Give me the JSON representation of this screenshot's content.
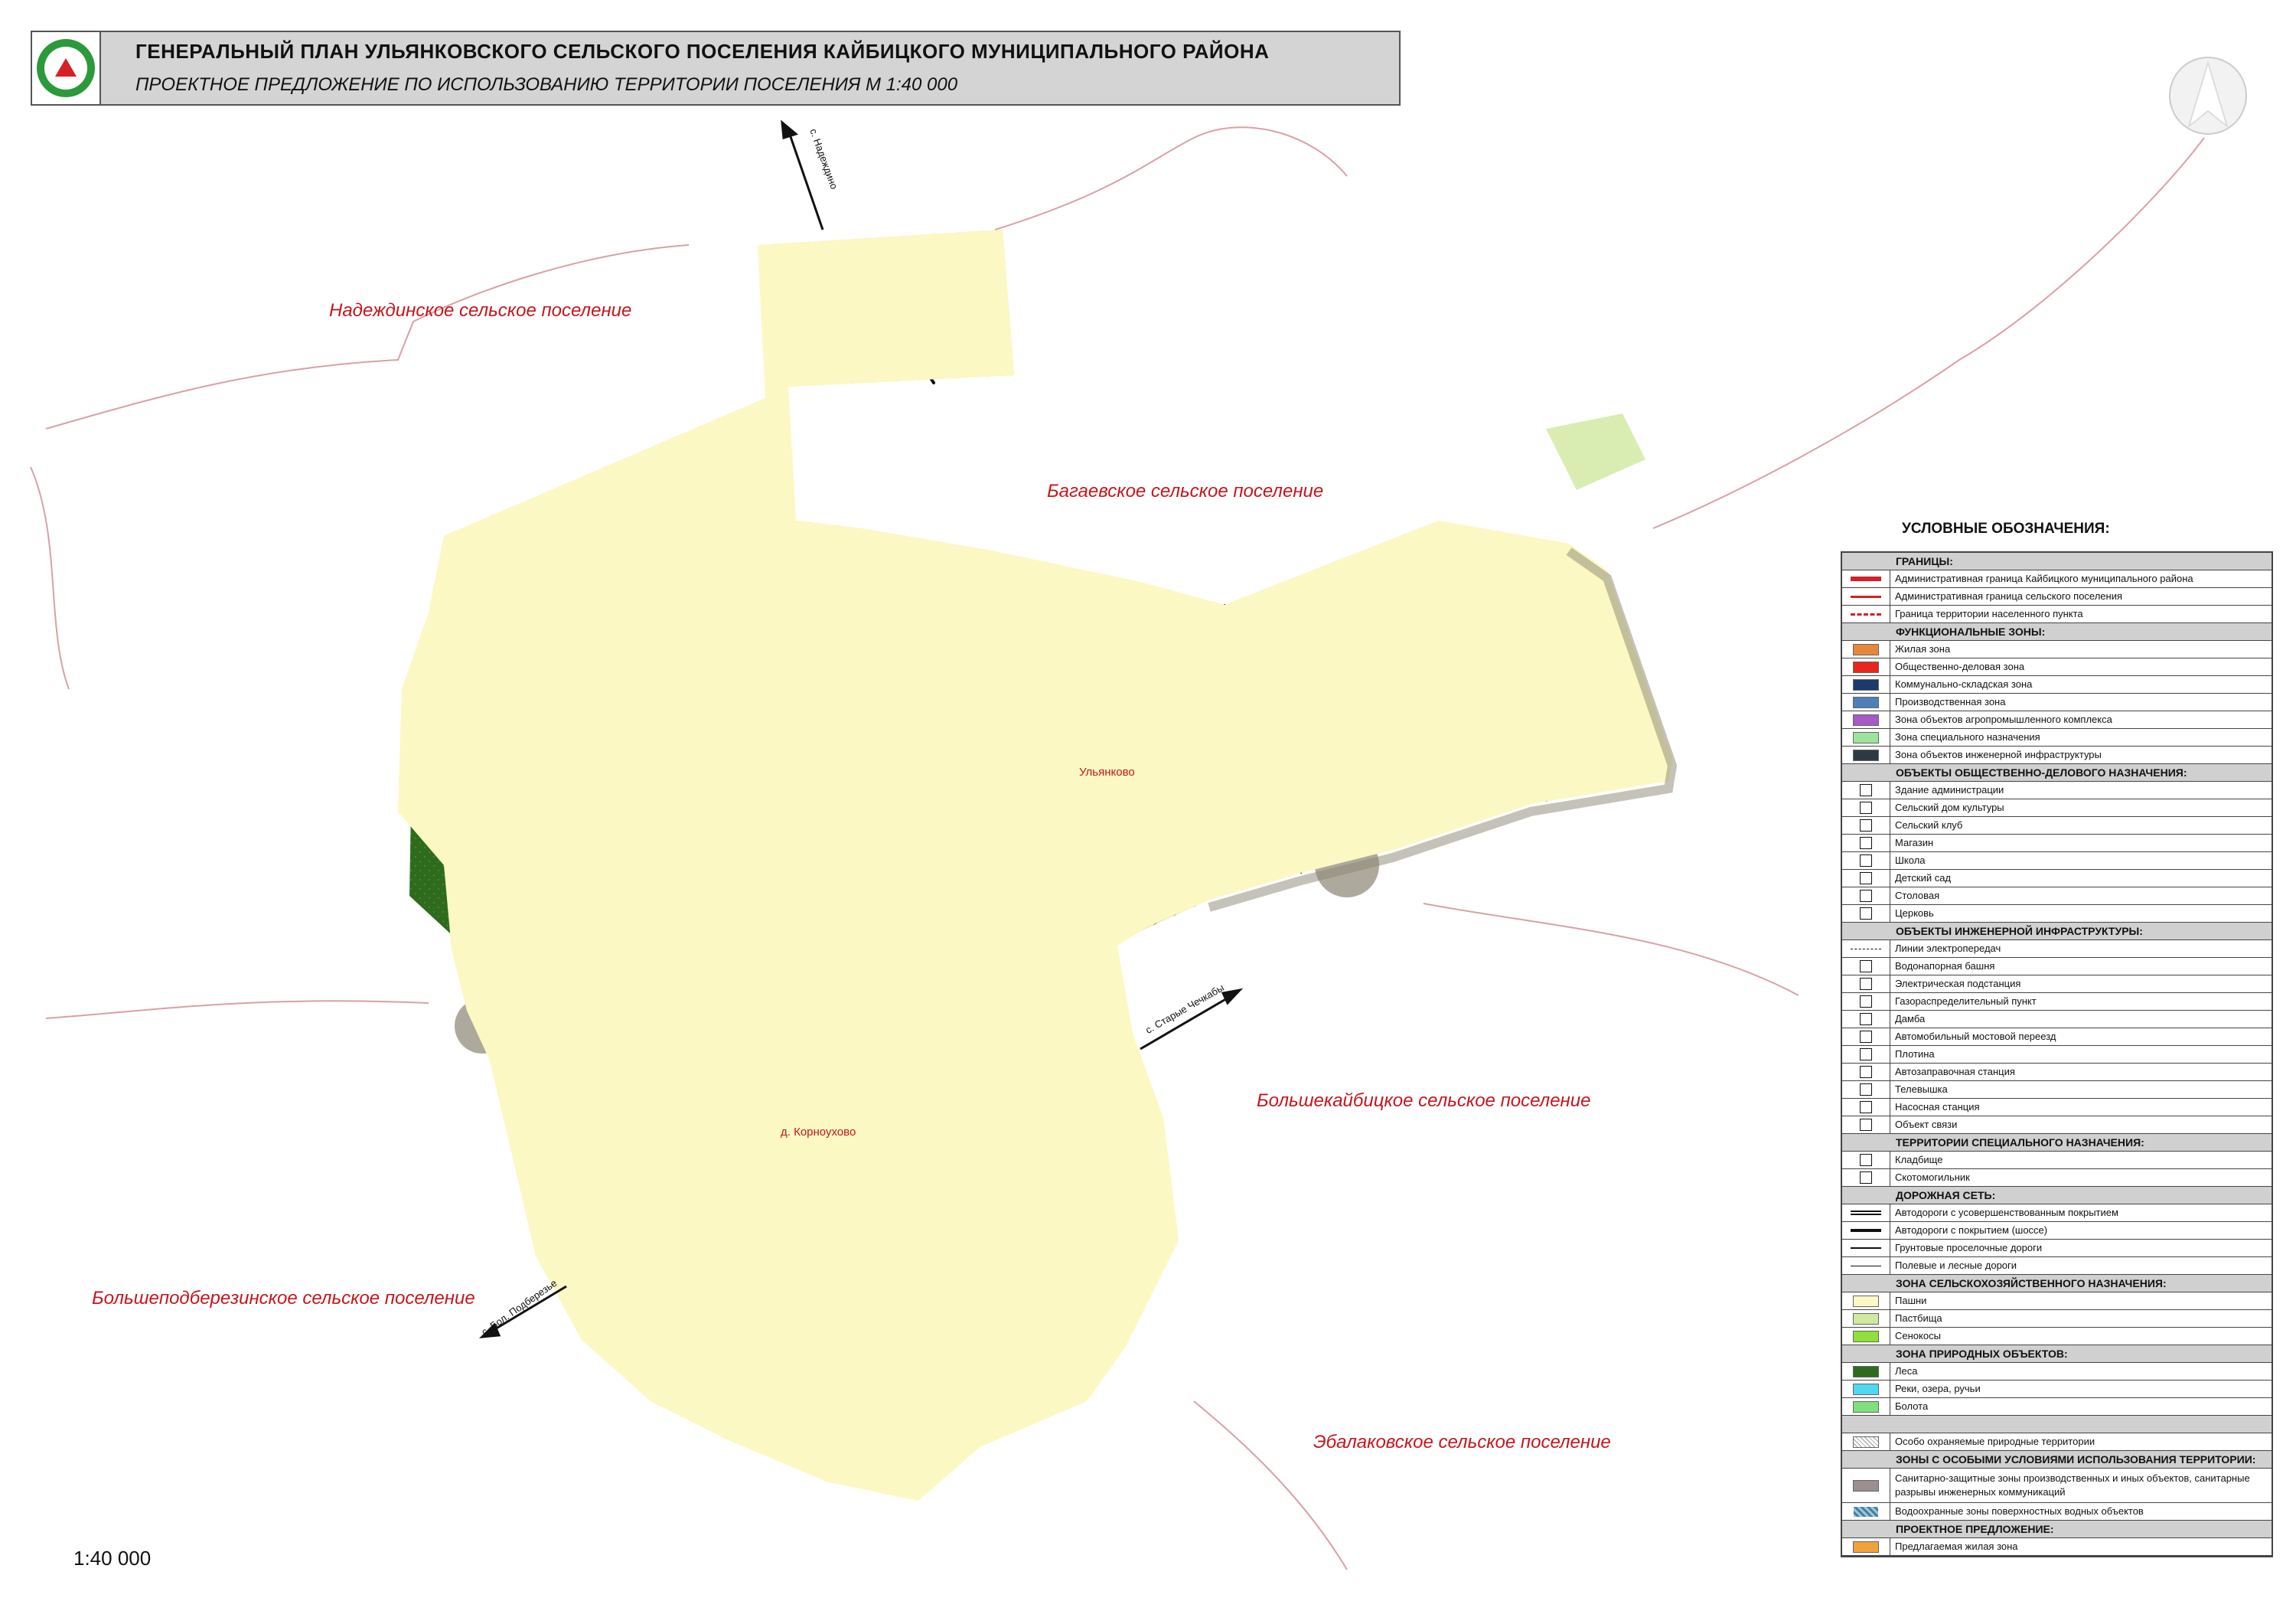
{
  "header": {
    "title": "ГЕНЕРАЛЬНЫЙ ПЛАН УЛЬЯНКОВСКОГО СЕЛЬСКОГО ПОСЕЛЕНИЯ КАЙБИЦКОГО МУНИЦИПАЛЬНОГО РАЙОНА",
    "subtitle": "ПРОЕКТНОЕ ПРЕДЛОЖЕНИЕ ПО  ИСПОЛЬЗОВАНИЮ ТЕРРИТОРИИ ПОСЕЛЕНИЯ  М 1:40 000"
  },
  "areas": {
    "nadezhdino": "Надеждинское сельское поселение",
    "bagaevo": "Багаевское сельское поселение",
    "bolshekaibitsy": "Большекайбицкое сельское поселение",
    "bolshepodberezino": "Большеподберезинское сельское поселение",
    "ebalakovo": "Эбалаковское сельское поселение"
  },
  "places": {
    "ulyankovo": "Ульянково",
    "korniukovo": "д. Корноухово",
    "road_north": "с. Надеждино",
    "road_east": "с. Старые Чечкабы",
    "road_southwest": "с. Бол. Подберезье"
  },
  "scale": "1:40 000",
  "colors": {
    "boundary": "#d42026",
    "arable": "#fbf8c3",
    "pasture": "#cfe9a0",
    "forest": "#2e6b1d",
    "water": "#4a8fb5",
    "sanitary": "#8c8573",
    "residential": "#e8a25a",
    "agro": "#a55ac8"
  },
  "legend": {
    "title": "УСЛОВНЫЕ ОБОЗНАЧЕНИЯ:",
    "sections": [
      {
        "title": "ГРАНИЦЫ:",
        "items": [
          {
            "sym": "line-red-thick",
            "label": "Административная граница Кайбицкого муниципального района"
          },
          {
            "sym": "line-red",
            "label": "Административная граница сельского поселения"
          },
          {
            "sym": "line-red-dash",
            "label": "Граница территории населенного пункта"
          }
        ]
      },
      {
        "title": "ФУНКЦИОНАЛЬНЫЕ ЗОНЫ:",
        "items": [
          {
            "sym": "rect:#e8863a",
            "label": "Жилая зона"
          },
          {
            "sym": "rect:#e8261c",
            "label": "Общественно-деловая зона"
          },
          {
            "sym": "rect:#1c3a6b",
            "label": "Коммунально-складская зона"
          },
          {
            "sym": "rect:#4f7fb8",
            "label": " Производственная зона"
          },
          {
            "sym": "rect:#a55ac8",
            "label": "Зона объектов агропромышленного комплекса"
          },
          {
            "sym": "rect:#9ce39c",
            "label": "Зона специального назначения"
          },
          {
            "sym": "rect:#2d3a44",
            "label": "Зона объектов инженерной инфраструктуры"
          }
        ]
      },
      {
        "title": "ОБЪЕКТЫ ОБЩЕСТВЕННО-ДЕЛОВОГО НАЗНАЧЕНИЯ:",
        "items": [
          {
            "sym": "icon",
            "label": "Здание администрации"
          },
          {
            "sym": "icon",
            "label": "Сельский дом культуры"
          },
          {
            "sym": "icon",
            "label": "Сельский клуб"
          },
          {
            "sym": "icon",
            "label": "Магазин"
          },
          {
            "sym": "icon",
            "label": "Школа"
          },
          {
            "sym": "icon",
            "label": "Детский сад"
          },
          {
            "sym": "icon",
            "label": "Столовая"
          },
          {
            "sym": "icon",
            "label": "Церковь"
          }
        ]
      },
      {
        "title": "ОБЪЕКТЫ ИНЖЕНЕРНОЙ ИНФРАСТРУКТУРЫ:",
        "items": [
          {
            "sym": "line-thin-dash",
            "label": "Линии электропередач"
          },
          {
            "sym": "icon",
            "label": "Водонапорная башня"
          },
          {
            "sym": "icon",
            "label": "Электрическая подстанция"
          },
          {
            "sym": "icon",
            "label": "Газораспределительный пункт"
          },
          {
            "sym": "icon",
            "label": "Дамба"
          },
          {
            "sym": "icon",
            "label": "Автомобильный мостовой переезд"
          },
          {
            "sym": "icon",
            "label": "Плотина"
          },
          {
            "sym": "icon",
            "label": "Автозаправочная станция"
          },
          {
            "sym": "icon",
            "label": "Телевышка"
          },
          {
            "sym": "icon",
            "label": "Насосная станция"
          },
          {
            "sym": "icon",
            "label": "Объект связи"
          }
        ]
      },
      {
        "title": "ТЕРРИТОРИИ СПЕЦИАЛЬНОГО НАЗНАЧЕНИЯ:",
        "items": [
          {
            "sym": "icon",
            "label": "Кладбище"
          },
          {
            "sym": "icon",
            "label": "Скотомогильник"
          }
        ]
      },
      {
        "title": "ДОРОЖНАЯ СЕТЬ:",
        "items": [
          {
            "sym": "line-double",
            "label": "Автодороги с усовершенствованным покрытием"
          },
          {
            "sym": "line-black-thick",
            "label": "Автодороги с покрытием (шоссе)"
          },
          {
            "sym": "line-black",
            "label": "Грунтовые проселочные дороги"
          },
          {
            "sym": "line-black-thin",
            "label": "Полевые и лесные дороги"
          }
        ]
      },
      {
        "title": "ЗОНА СЕЛЬСКОХОЗЯЙСТВЕННОГО НАЗНАЧЕНИЯ:",
        "items": [
          {
            "sym": "rect:#fbf8c3",
            "label": "Пашни"
          },
          {
            "sym": "rect:#cfe9a0",
            "label": "Пастбища"
          },
          {
            "sym": "rect:#8fe03a",
            "label": "Сенокосы"
          }
        ]
      },
      {
        "title": "ЗОНА ПРИРОДНЫХ ОБЪЕКТОВ:",
        "items": [
          {
            "sym": "rect:#2e6b1d",
            "label": "Леса"
          },
          {
            "sym": "rect:#4fd8f0",
            "label": "Реки, озера, ручьи"
          },
          {
            "sym": "rect:#7fe07f",
            "label": "Болота"
          }
        ]
      },
      {
        "title": "",
        "items": [
          {
            "sym": "hatch",
            "label": "Особо охраняемые природные территории"
          }
        ]
      },
      {
        "title": "ЗОНЫ С ОСОБЫМИ УСЛОВИЯМИ ИСПОЛЬЗОВАНИЯ ТЕРРИТОРИИ:",
        "items": [
          {
            "sym": "rect:#9b8f8f",
            "label": "Санитарно-защитные зоны производственных и иных объектов, санитарные разрывы инженерных коммуникаций",
            "tall": true
          },
          {
            "sym": "water-hatch",
            "label": "Водоохранные зоны поверхностных водных объектов"
          }
        ]
      },
      {
        "title": "ПРОЕКТНОЕ ПРЕДЛОЖЕНИЕ:",
        "items": [
          {
            "sym": "rect:#f2a23a",
            "label": "Предлагаемая жилая зона"
          }
        ]
      }
    ]
  }
}
